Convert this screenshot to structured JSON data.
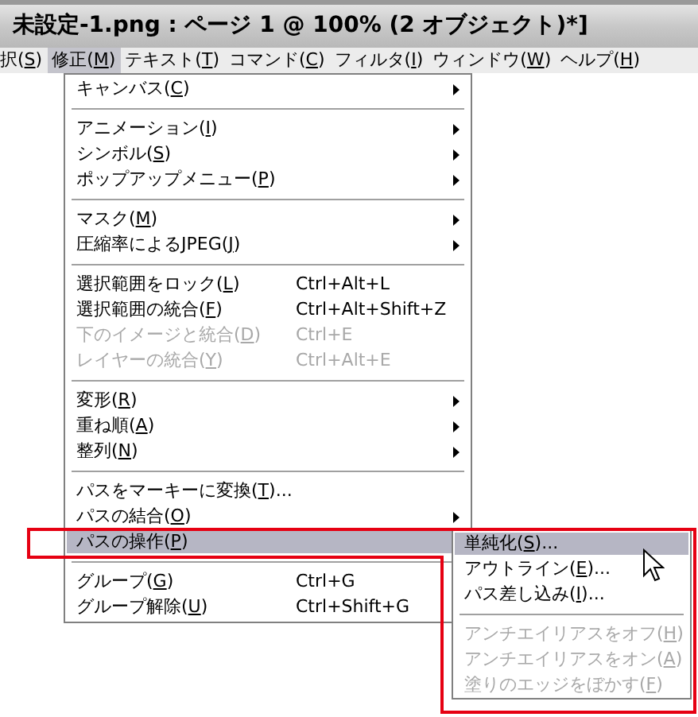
{
  "window": {
    "title": "未設定-1.png : ページ 1 @ 100% (2 オブジェクト)*]"
  },
  "menubar": [
    {
      "label": "択(S)",
      "selected": false
    },
    {
      "label": "修正(M)",
      "selected": true
    },
    {
      "label": "テキスト(T)",
      "selected": false
    },
    {
      "label": "コマンド(C)",
      "selected": false
    },
    {
      "label": "フィルタ(I)",
      "selected": false
    },
    {
      "label": "ウィンドウ(W)",
      "selected": false
    },
    {
      "label": "ヘルプ(H)",
      "selected": false
    }
  ],
  "menu": {
    "items": [
      {
        "kind": "item",
        "label": "キャンバス(C)",
        "submenu": true,
        "disabled": false,
        "selected": false
      },
      {
        "kind": "separator"
      },
      {
        "kind": "item",
        "label": "アニメーション(I)",
        "submenu": true,
        "disabled": false,
        "selected": false
      },
      {
        "kind": "item",
        "label": "シンボル(S)",
        "submenu": true,
        "disabled": false,
        "selected": false
      },
      {
        "kind": "item",
        "label": "ポップアップメニュー(P)",
        "submenu": true,
        "disabled": false,
        "selected": false
      },
      {
        "kind": "separator"
      },
      {
        "kind": "item",
        "label": "マスク(M)",
        "submenu": true,
        "disabled": false,
        "selected": false
      },
      {
        "kind": "item",
        "label": "圧縮率によるJPEG(J)",
        "submenu": true,
        "disabled": false,
        "selected": false
      },
      {
        "kind": "separator"
      },
      {
        "kind": "item",
        "label": "選択範囲をロック(L)",
        "shortcut": "Ctrl+Alt+L",
        "submenu": false,
        "disabled": false,
        "selected": false
      },
      {
        "kind": "item",
        "label": "選択範囲の統合(F)",
        "shortcut": "Ctrl+Alt+Shift+Z",
        "submenu": false,
        "disabled": false,
        "selected": false
      },
      {
        "kind": "item",
        "label": "下のイメージと統合(D)",
        "shortcut": "Ctrl+E",
        "submenu": false,
        "disabled": true,
        "selected": false
      },
      {
        "kind": "item",
        "label": "レイヤーの統合(Y)",
        "shortcut": "Ctrl+Alt+E",
        "submenu": false,
        "disabled": true,
        "selected": false
      },
      {
        "kind": "separator"
      },
      {
        "kind": "item",
        "label": "変形(R)",
        "submenu": true,
        "disabled": false,
        "selected": false
      },
      {
        "kind": "item",
        "label": "重ね順(A)",
        "submenu": true,
        "disabled": false,
        "selected": false
      },
      {
        "kind": "item",
        "label": "整列(N)",
        "submenu": true,
        "disabled": false,
        "selected": false
      },
      {
        "kind": "separator"
      },
      {
        "kind": "item",
        "label": "パスをマーキーに変換(T)...",
        "submenu": false,
        "disabled": false,
        "selected": false
      },
      {
        "kind": "item",
        "label": "パスの結合(O)",
        "submenu": true,
        "disabled": false,
        "selected": false
      },
      {
        "kind": "item",
        "label": "パスの操作(P)",
        "submenu": true,
        "disabled": false,
        "selected": true
      },
      {
        "kind": "separator"
      },
      {
        "kind": "item",
        "label": "グループ(G)",
        "shortcut": "Ctrl+G",
        "submenu": false,
        "disabled": false,
        "selected": false
      },
      {
        "kind": "item",
        "label": "グループ解除(U)",
        "shortcut": "Ctrl+Shift+G",
        "submenu": false,
        "disabled": false,
        "selected": false
      }
    ]
  },
  "submenu": {
    "items": [
      {
        "kind": "item",
        "label": "単純化(S)...",
        "submenu": false,
        "disabled": false,
        "selected": true
      },
      {
        "kind": "item",
        "label": "アウトライン(E)...",
        "submenu": false,
        "disabled": false,
        "selected": false
      },
      {
        "kind": "item",
        "label": "パス差し込み(I)...",
        "submenu": false,
        "disabled": false,
        "selected": false
      },
      {
        "kind": "separator"
      },
      {
        "kind": "item",
        "label": "アンチエイリアスをオフ(H)",
        "submenu": false,
        "disabled": true,
        "selected": false
      },
      {
        "kind": "item",
        "label": "アンチエイリアスをオン(A)",
        "submenu": false,
        "disabled": true,
        "selected": false
      },
      {
        "kind": "item",
        "label": "塗りのエッジをぼかす(F)",
        "submenu": false,
        "disabled": true,
        "selected": false
      }
    ]
  }
}
